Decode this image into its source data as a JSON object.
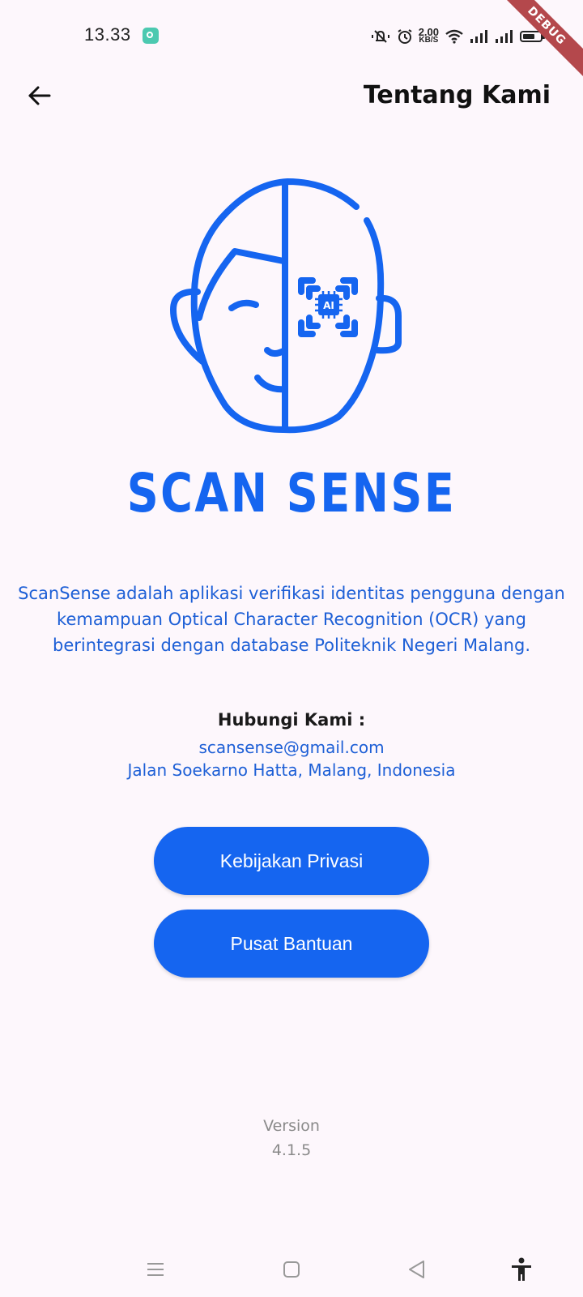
{
  "status_bar": {
    "time": "13.33",
    "net_speed_value": "2.00",
    "net_speed_unit": "KB/S",
    "icons": [
      "chat-app-icon",
      "mute-vibrate-icon",
      "alarm-icon",
      "wifi-icon",
      "signal-icon",
      "signal-icon",
      "battery-icon"
    ]
  },
  "debug_banner": "DEBUG",
  "app_bar": {
    "title": "Tentang Kami",
    "back_icon": "arrow-left-icon"
  },
  "logo": {
    "badge_text": "AI",
    "brand_name": "SCAN SENSE"
  },
  "description": "ScanSense adalah aplikasi verifikasi identitas pengguna dengan kemampuan Optical Character Recognition (OCR) yang berintegrasi dengan database Politeknik Negeri Malang.",
  "contact": {
    "heading": "Hubungi Kami :",
    "email": "scansense@gmail.com",
    "address": "Jalan Soekarno Hatta, Malang, Indonesia"
  },
  "buttons": {
    "privacy_label": "Kebijakan Privasi",
    "help_label": "Pusat Bantuan"
  },
  "version": {
    "label": "Version",
    "number": "4.1.5"
  },
  "nav_bar": {
    "icons": [
      "menu-icon",
      "home-icon",
      "back-icon",
      "accessibility-icon"
    ]
  },
  "colors": {
    "primary": "#1565f0",
    "text_blue": "#1d5fd6",
    "background": "#fdf7fc",
    "debug": "#b4484c"
  }
}
